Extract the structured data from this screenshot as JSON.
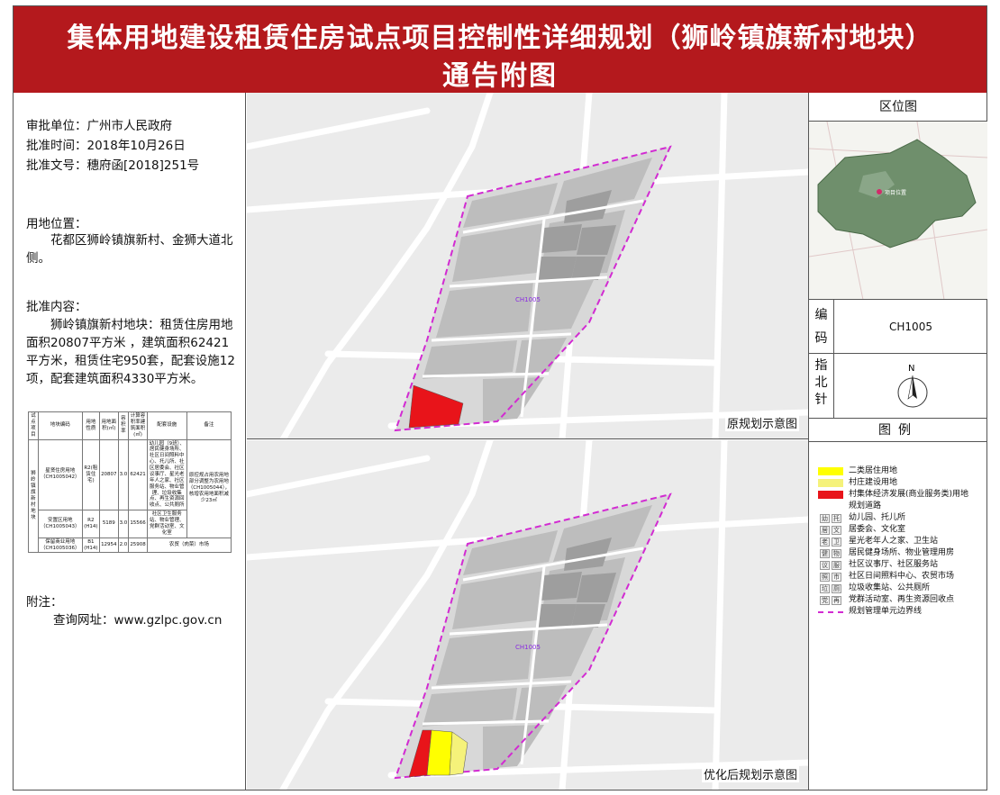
{
  "header": {
    "title_line1": "集体用地建设租赁住房试点项目控制性详细规划（狮岭镇旗新村地块）",
    "title_line2": "通告附图"
  },
  "approval": {
    "unit": "审批单位：广州市人民政府",
    "time": "批准时间：2018年10月26日",
    "doc_no": "批准文号：穗府函[2018]251号"
  },
  "location": {
    "heading": "用地位置：",
    "text": "花都区狮岭镇旗新村、金狮大道北侧。"
  },
  "content": {
    "heading": "批准内容：",
    "text": "狮岭镇旗新村地块：租赁住房用地面积20807平方米 ，建筑面积62421平方米，租赁住宅950套，配套设施12项，配套建筑面积4330平方米。"
  },
  "land_table": {
    "headers": [
      "试点项目",
      "地块编码",
      "用地性质",
      "用地面积(㎡)",
      "容积率",
      "计算容积率建筑面积(㎡)",
      "配套设施",
      "备注"
    ],
    "project": "狮岭镇旗新村地块",
    "remark": "原控规占用农用地部分调整为农用地（CH1005044），核增农用地面积减少23㎡",
    "rows": [
      {
        "code": "星贤住房用地（CH1005042）",
        "nature": "R2(租赁住宅)",
        "area": "20807",
        "far": "3.0",
        "gfa": "62421",
        "facilities": "幼儿园（9班）、居民健身场所、社区日间照料中心、托儿所、社区居委会、社区议事厅、星光老年人之家、社区服务站、物业管理、垃圾收集点、再生资源回收点、公共厕所"
      },
      {
        "code": "安置区用地（CH1005043）",
        "nature": "R2 (H14)",
        "area": "5189",
        "far": "3.0",
        "gfa": "15566",
        "facilities": "社区卫生服务站、物业管理、党群活动室、文化室"
      },
      {
        "code": "保留商业用地（CH1005036）",
        "nature": "B1 (H14)",
        "area": "12954",
        "far": "2.0",
        "gfa": "25908",
        "facilities": "农贸（肉菜）市场"
      }
    ]
  },
  "notes": {
    "heading": "附注：",
    "url": "查询网址：www.gzlpc.gov.cn"
  },
  "maps": {
    "original_caption": "原规划示意图",
    "optimized_caption": "优化后规划示意图",
    "unit_label": "CH1005"
  },
  "sidebar": {
    "location_heading": "区位图",
    "code_key": "编码",
    "code_value": "CH1005",
    "north_key": "指北针",
    "north_letter": "N",
    "legend_heading": "图例",
    "location_marker_label": "项目位置"
  },
  "legend": [
    {
      "type": "swatch",
      "color": "#ffff00",
      "label": "二类居住用地"
    },
    {
      "type": "swatch",
      "color": "#f5f27a",
      "label": "村庄建设用地"
    },
    {
      "type": "swatch",
      "color": "#e8141a",
      "label": "村集体经济发展(商业服务类)用地"
    },
    {
      "type": "none",
      "label": "规划道路"
    },
    {
      "type": "icons",
      "label": "幼儿园、托儿所"
    },
    {
      "type": "icons",
      "label": "居委会、文化室"
    },
    {
      "type": "icons",
      "label": "星光老年人之家、卫生站"
    },
    {
      "type": "icons",
      "label": "居民健身场所、物业管理用房"
    },
    {
      "type": "icons",
      "label": "社区议事厅、社区服务站"
    },
    {
      "type": "icons",
      "label": "社区日间照料中心、农贸市场"
    },
    {
      "type": "icons",
      "label": "垃圾收集站、公共厕所"
    },
    {
      "type": "icons",
      "label": "党群活动室、再生资源回收点"
    },
    {
      "type": "line",
      "color": "#d22bd2",
      "label": "规划管理单元边界线"
    }
  ],
  "colors": {
    "banner": "#b4191d",
    "boundary": "#d22bd2",
    "commercial_red": "#e8141a",
    "residential_yellow": "#ffff00"
  }
}
